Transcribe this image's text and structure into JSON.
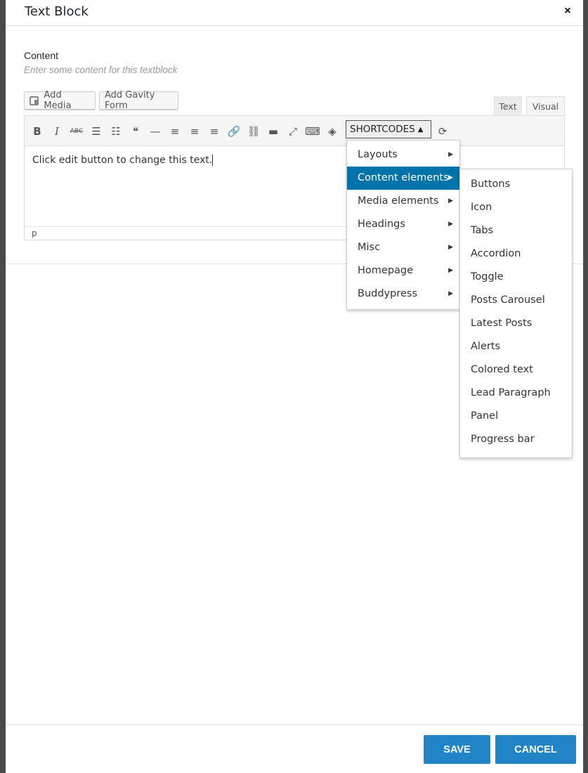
{
  "modal": {
    "title": "Text Block",
    "close_icon": "×"
  },
  "field": {
    "label": "Content",
    "description": "Enter some content for this textblock"
  },
  "buttons": {
    "add_media": "Add Media",
    "add_gravity_form": "Add Gavity Form"
  },
  "tabs": {
    "text": "Text",
    "visual": "Visual"
  },
  "toolbar": {
    "icons": [
      {
        "name": "bold-icon",
        "glyph": "B"
      },
      {
        "name": "italic-icon",
        "glyph": "I"
      },
      {
        "name": "strikethrough-icon",
        "glyph": "ABC"
      },
      {
        "name": "bullet-list-icon",
        "glyph": "☰"
      },
      {
        "name": "numbered-list-icon",
        "glyph": "☷"
      },
      {
        "name": "blockquote-icon",
        "glyph": "❝"
      },
      {
        "name": "horizontal-rule-icon",
        "glyph": "—"
      },
      {
        "name": "align-left-icon",
        "glyph": "≡"
      },
      {
        "name": "align-center-icon",
        "glyph": "≡"
      },
      {
        "name": "align-right-icon",
        "glyph": "≡"
      },
      {
        "name": "link-icon",
        "glyph": "🔗"
      },
      {
        "name": "unlink-icon",
        "glyph": "⛓"
      },
      {
        "name": "read-more-icon",
        "glyph": "▬"
      },
      {
        "name": "fullscreen-icon",
        "glyph": "⤢"
      },
      {
        "name": "toolbar-toggle-icon",
        "glyph": "⌨"
      },
      {
        "name": "layers-icon",
        "glyph": "◈"
      }
    ],
    "shortcodes_label": "SHORTCODES",
    "shortcodes_caret": "▲",
    "refresh_icon": "⟳"
  },
  "editor": {
    "content": "Click edit button to change this text.",
    "status_path": "p"
  },
  "shortcodes_menu": {
    "categories": [
      {
        "label": "Layouts",
        "arrow": "▶"
      },
      {
        "label": "Content elements",
        "arrow": "▶"
      },
      {
        "label": "Media elements",
        "arrow": "▶"
      },
      {
        "label": "Headings",
        "arrow": "▶"
      },
      {
        "label": "Misc",
        "arrow": "▶"
      },
      {
        "label": "Homepage",
        "arrow": "▶"
      },
      {
        "label": "Buddypress",
        "arrow": "▶"
      }
    ],
    "active_index": 1,
    "submenu_items": [
      "Buttons",
      "Icon",
      "Tabs",
      "Accordion",
      "Toggle",
      "Posts Carousel",
      "Latest Posts",
      "Alerts",
      "Colored text",
      "Lead Paragraph",
      "Panel",
      "Progress bar"
    ]
  },
  "actions": {
    "save": "SAVE",
    "cancel": "CANCEL"
  },
  "colors": {
    "accent": "#0073aa",
    "button": "#2184c7"
  }
}
